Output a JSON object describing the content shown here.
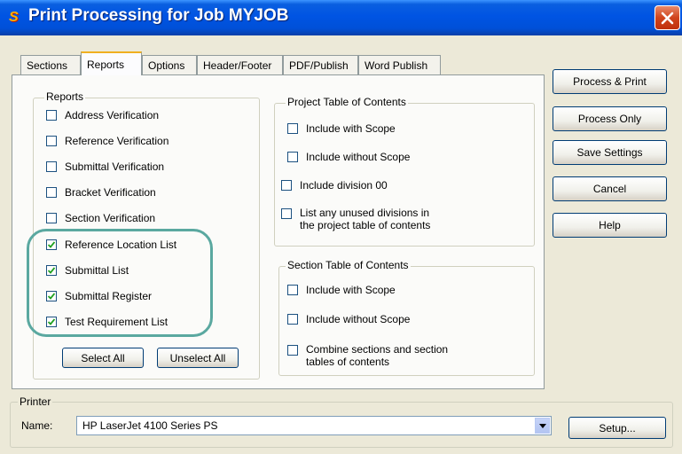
{
  "window": {
    "title": "Print Processing for Job MYJOB",
    "app_icon": "S",
    "close_icon": "close-icon"
  },
  "tabs": [
    {
      "label": "Sections",
      "active": false
    },
    {
      "label": "Reports",
      "active": true
    },
    {
      "label": "Options",
      "active": false
    },
    {
      "label": "Header/Footer",
      "active": false
    },
    {
      "label": "PDF/Publish",
      "active": false
    },
    {
      "label": "Word Publish",
      "active": false
    }
  ],
  "reports": {
    "label": "Reports",
    "items": [
      {
        "label": "Address Verification",
        "checked": false
      },
      {
        "label": "Reference Verification",
        "checked": false
      },
      {
        "label": "Submittal Verification",
        "checked": false
      },
      {
        "label": "Bracket Verification",
        "checked": false
      },
      {
        "label": "Section Verification",
        "checked": false
      },
      {
        "label": "Reference Location List",
        "checked": true
      },
      {
        "label": "Submittal List",
        "checked": true
      },
      {
        "label": "Submittal Register",
        "checked": true
      },
      {
        "label": "Test Requirement List",
        "checked": true
      }
    ],
    "select_all_label": "Select All",
    "unselect_all_label": "Unselect All"
  },
  "project_toc": {
    "label": "Project Table of Contents",
    "include_with_scope": {
      "label": "Include with Scope",
      "checked": false
    },
    "include_without_scope": {
      "label": "Include without Scope",
      "checked": false
    },
    "include_division_00": {
      "label": "Include division 00",
      "checked": false
    },
    "list_unused_divisions": {
      "label_line1": "List any unused divisions in",
      "label_line2": "the project table of contents",
      "checked": false
    }
  },
  "section_toc": {
    "label": "Section Table of Contents",
    "include_with_scope": {
      "label": "Include with Scope",
      "checked": false
    },
    "include_without_scope": {
      "label": "Include without Scope",
      "checked": false
    },
    "combine_sections": {
      "label_line1": "Combine sections and section",
      "label_line2": "tables of contents",
      "checked": false
    }
  },
  "actions": {
    "process_print": "Process & Print",
    "process_only": "Process Only",
    "save_settings": "Save Settings",
    "cancel": "Cancel",
    "help": "Help"
  },
  "printer": {
    "label": "Printer",
    "name_label": "Name:",
    "selected": "HP LaserJet 4100 Series PS",
    "setup_label": "Setup..."
  },
  "colors": {
    "titlebar": "#0054e3",
    "dialog_bg": "#ece9d8",
    "highlight": "#5aa8a0",
    "tab_active_accent": "#f0b020"
  }
}
